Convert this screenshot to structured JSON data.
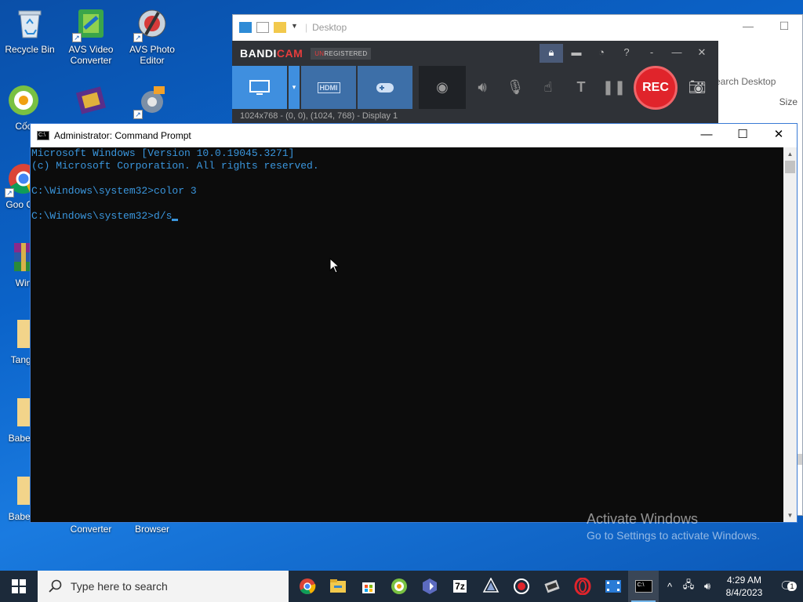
{
  "desktop": {
    "icons": [
      {
        "label": "Recycle Bin"
      },
      {
        "label": "AVS Video Converter"
      },
      {
        "label": "AVS Photo Editor"
      },
      {
        "label": "Cốc"
      },
      {
        "label": "Goo Chr"
      },
      {
        "label": "Win"
      },
      {
        "label": "Tangu"
      },
      {
        "label": "BabelS"
      },
      {
        "label": "BabelS"
      },
      {
        "label": "Converter"
      },
      {
        "label": "Browser"
      }
    ]
  },
  "explorer": {
    "title": "Desktop",
    "search_placeholder": "earch Desktop",
    "size_column": "Size",
    "minimize": "—",
    "maximize": "☐"
  },
  "bandicam": {
    "logo_main": "BANDI",
    "logo_accent": "CAM",
    "unregistered_prefix": "UN",
    "unregistered_rest": "REGISTERED",
    "rec_label": "REC",
    "status_text": "1024x768 - (0, 0), (1024, 768) - Display 1",
    "hdmi_label": "HDMI"
  },
  "cmd": {
    "title": "Administrator:  Command Prompt",
    "lines": [
      "Microsoft Windows [Version 10.0.19045.3271]",
      "(c) Microsoft Corporation. All rights reserved.",
      "",
      "C:\\Windows\\system32>color 3",
      "",
      "C:\\Windows\\system32>d/s"
    ],
    "text_color": "#3a96dd"
  },
  "watermark": {
    "line1": "Activate Windows",
    "line2": "Go to Settings to activate Windows."
  },
  "taskbar": {
    "search_placeholder": "Type here to search",
    "time": "4:29 AM",
    "date": "8/4/2023",
    "notification_count": "1",
    "apps": [
      "chrome-icon",
      "file-explorer-icon",
      "store-icon",
      "coc-coc-icon",
      "power-automate-icon",
      "7zip-icon",
      "inkscape-icon",
      "bandicam-icon",
      "avs-video-icon",
      "opera-icon",
      "video-editor-icon",
      "command-prompt-icon"
    ]
  },
  "colors": {
    "desktop_bg": "#0b63c9",
    "taskbar_bg": "#1c2a3a",
    "rec_red": "#e0242b",
    "bandicam_accent": "#3f8fdf"
  }
}
